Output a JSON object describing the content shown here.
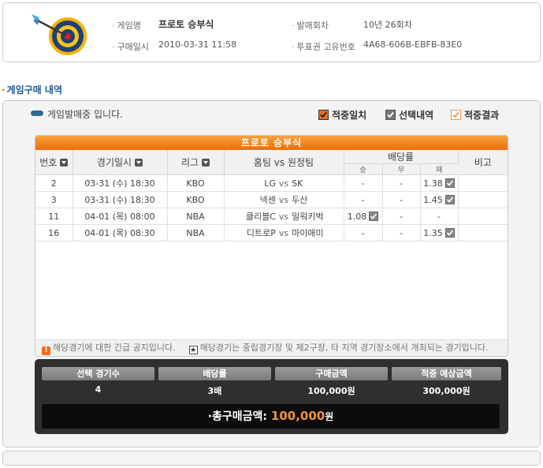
{
  "ticket": {
    "game_name_label": "게임명",
    "game_name": "프로토 승부식",
    "round_label": "발매회차",
    "round": "10년 26회차",
    "purchase_time_label": "구매일시",
    "purchase_time": "2010-03-31 11:58",
    "ticket_id_label": "투표권 고유번호",
    "ticket_id": "4A68-606B-EBFB-83E0"
  },
  "section_title": "게임구매 내역",
  "status_text": "게임발매중 입니다.",
  "legend": {
    "hit": "적중일치",
    "selected": "선택내역",
    "result": "적중결과"
  },
  "panel_title": "프로토 승부식",
  "table": {
    "headers": {
      "no": "번호",
      "datetime": "경기일시",
      "league": "리그",
      "teams": "홈팀 vs 원정팀",
      "odds": "배당률",
      "win": "승",
      "draw": "무",
      "lose": "패",
      "note": "비고"
    },
    "vs": "vs",
    "rows": [
      {
        "no": "2",
        "datetime": "03-31 (수) 18:30",
        "league": "KBO",
        "home": "LG",
        "away": "SK",
        "win": "-",
        "draw": "-",
        "lose": "1.38",
        "pick": "lose"
      },
      {
        "no": "3",
        "datetime": "03-31 (수) 18:30",
        "league": "KBO",
        "home": "넥센",
        "away": "두산",
        "win": "-",
        "draw": "-",
        "lose": "1.45",
        "pick": "lose"
      },
      {
        "no": "11",
        "datetime": "04-01 (목) 08:00",
        "league": "NBA",
        "home": "클리블C",
        "away": "밀워키벅",
        "win": "1.08",
        "draw": "-",
        "lose": "-",
        "pick": "win"
      },
      {
        "no": "16",
        "datetime": "04-01 (목) 08:30",
        "league": "NBA",
        "home": "디트로P",
        "away": "마이애미",
        "win": "-",
        "draw": "-",
        "lose": "1.35",
        "pick": "lose"
      }
    ]
  },
  "notices": {
    "urgent": "해당경기에 대한 긴급 공지입니다.",
    "neutral": "해당경기는 중립경기장 및 제2구장, 타 지역 경기장소에서 개최되는 경기입니다."
  },
  "summary": {
    "headers": [
      "선택 경기수",
      "배당률",
      "구매금액",
      "적중 예상금액"
    ],
    "values": [
      "4",
      "3배",
      "100,000원",
      "300,000원"
    ],
    "total_label": "총구매금액:",
    "total_amount": "100,000",
    "total_unit": "원"
  },
  "colors": {
    "accent_orange": "#ea6f0a",
    "title_blue": "#1f5a8f",
    "summary_bg": "#2f2f2f"
  }
}
